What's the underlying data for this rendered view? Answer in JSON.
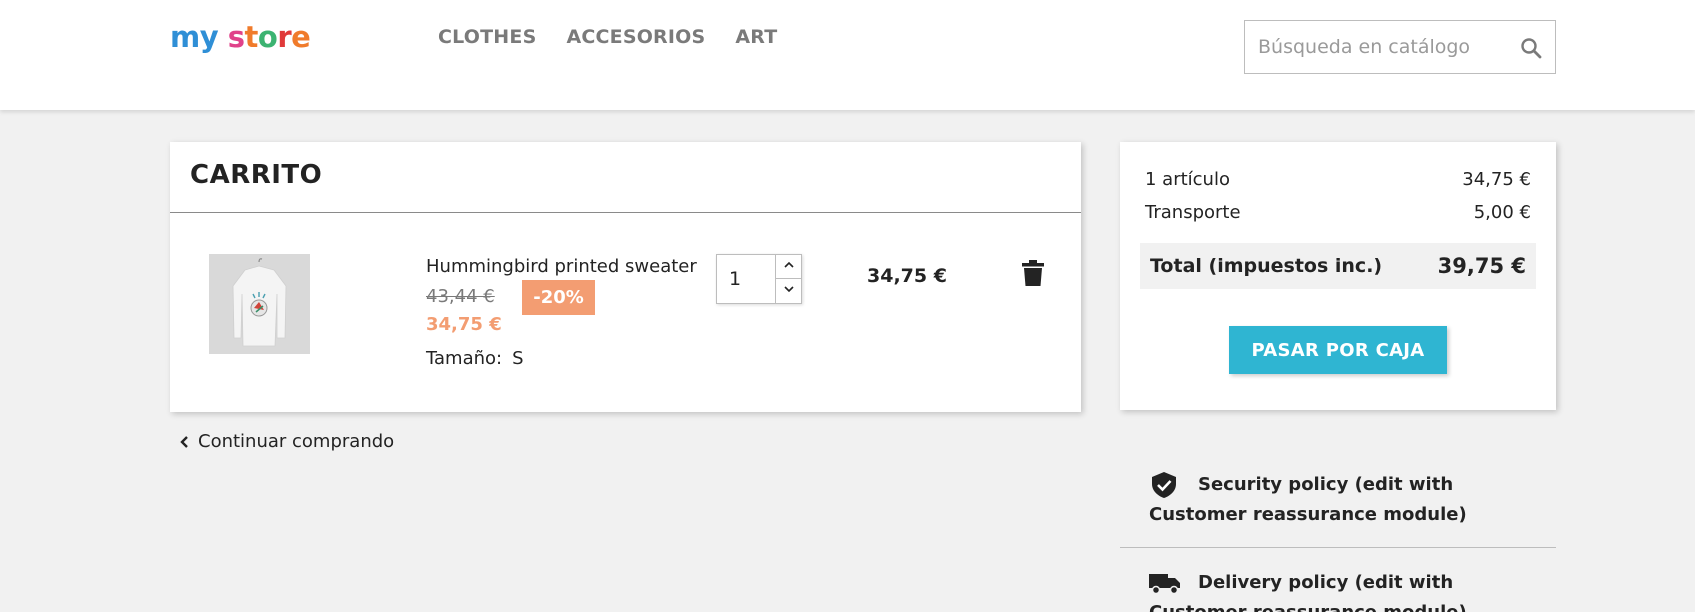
{
  "header": {
    "logo": [
      "m",
      "y",
      " ",
      "s",
      "t",
      "o",
      "r",
      "e"
    ],
    "nav": [
      {
        "label": "CLOTHES"
      },
      {
        "label": "ACCESORIOS"
      },
      {
        "label": "ART"
      }
    ],
    "search": {
      "placeholder": "Búsqueda en catálogo",
      "value": ""
    }
  },
  "cart": {
    "title": "CARRITO",
    "item": {
      "name": "Hummingbird printed sweater",
      "old_price": "43,44 €",
      "discount": "-20%",
      "new_price": "34,75 €",
      "size_label": "Tamaño:",
      "size_value": "S",
      "quantity": "1",
      "line_total": "34,75 €"
    },
    "continue_label": "Continuar comprando"
  },
  "summary": {
    "items_label": "1 artículo",
    "items_value": "34,75 €",
    "shipping_label": "Transporte",
    "shipping_value": "5,00 €",
    "total_label": "Total (impuestos inc.)",
    "total_value": "39,75 €",
    "checkout_label": "PASAR POR CAJA"
  },
  "reassurance": [
    {
      "icon": "shield-check-icon",
      "label": "Security policy (edit with Customer reassurance module)"
    },
    {
      "icon": "truck-icon",
      "label": "Delivery policy (edit with Customer reassurance module)"
    }
  ],
  "colors": {
    "accent": "#2fb5d2",
    "discount": "#f39d72",
    "background": "#f1f1f1"
  }
}
